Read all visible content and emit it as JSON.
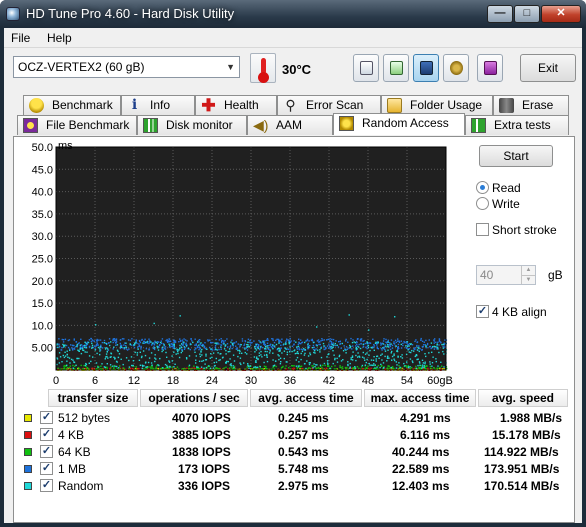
{
  "window": {
    "title": "HD Tune Pro 4.60 - Hard Disk Utility",
    "minimize": "—",
    "maximize": "□",
    "close": "✕"
  },
  "menu": [
    {
      "label": "File"
    },
    {
      "label": "Help"
    }
  ],
  "toolbar": {
    "drive": "OCZ-VERTEX2 (60 gB)",
    "temperature": "30°C",
    "exit_label": "Exit"
  },
  "tabs_row1": [
    {
      "label": "Benchmark",
      "icon": "benchmark-icon"
    },
    {
      "label": "Info",
      "icon": "info-icon"
    },
    {
      "label": "Health",
      "icon": "health-icon"
    },
    {
      "label": "Error Scan",
      "icon": "error-scan-icon"
    },
    {
      "label": "Folder Usage",
      "icon": "folder-icon"
    },
    {
      "label": "Erase",
      "icon": "trash-icon"
    }
  ],
  "tabs_row2": [
    {
      "label": "File Benchmark",
      "icon": "file-benchmark-icon"
    },
    {
      "label": "Disk monitor",
      "icon": "disk-monitor-icon"
    },
    {
      "label": "AAM",
      "icon": "speaker-icon"
    },
    {
      "label": "Random Access",
      "icon": "random-access-icon",
      "selected": true
    },
    {
      "label": "Extra tests",
      "icon": "extra-tests-icon"
    }
  ],
  "controls": {
    "start_label": "Start",
    "read_label": "Read",
    "write_label": "Write",
    "mode": "Read",
    "short_stroke_label": "Short stroke",
    "short_stroke_checked": false,
    "short_stroke_value": "40",
    "short_stroke_unit": "gB",
    "align_label": "4 KB align",
    "align_checked": true
  },
  "chart_data": {
    "type": "scatter",
    "y_unit": "ms",
    "ylim": [
      0,
      50
    ],
    "xlim": [
      0,
      60
    ],
    "y_ticks": [
      "50.0",
      "45.0",
      "40.0",
      "35.0",
      "30.0",
      "25.0",
      "20.0",
      "15.0",
      "10.0",
      "5.00"
    ],
    "x_ticks": [
      "0",
      "6",
      "12",
      "18",
      "24",
      "30",
      "36",
      "42",
      "48",
      "54",
      "60gB"
    ],
    "background": "#202020",
    "grid": true,
    "series": [
      {
        "name": "512 bytes",
        "color": "#e8e800",
        "band": [
          0.1,
          0.5
        ]
      },
      {
        "name": "4 KB",
        "color": "#dd1010",
        "band": [
          0.1,
          0.6
        ]
      },
      {
        "name": "64 KB",
        "color": "#10c010",
        "band": [
          0.3,
          1.2
        ]
      },
      {
        "name": "1 MB",
        "color": "#1e73dc",
        "band": [
          4.6,
          7.2
        ]
      },
      {
        "name": "Random",
        "color": "#20d8d8",
        "band": [
          0.5,
          6.5
        ]
      }
    ]
  },
  "results": {
    "headers": [
      "transfer size",
      "operations / sec",
      "avg. access time",
      "max. access time",
      "avg. speed"
    ],
    "rows": [
      {
        "name": "512 bytes",
        "ops": "4070 IOPS",
        "avg": "0.245 ms",
        "max": "4.291 ms",
        "speed": "1.988 MB/s",
        "color": "#e8e800"
      },
      {
        "name": "4 KB",
        "ops": "3885 IOPS",
        "avg": "0.257 ms",
        "max": "6.116 ms",
        "speed": "15.178 MB/s",
        "color": "#dd1010"
      },
      {
        "name": "64 KB",
        "ops": "1838 IOPS",
        "avg": "0.543 ms",
        "max": "40.244 ms",
        "speed": "114.922 MB/s",
        "color": "#10c010"
      },
      {
        "name": "1 MB",
        "ops": "173 IOPS",
        "avg": "5.748 ms",
        "max": "22.589 ms",
        "speed": "173.951 MB/s",
        "color": "#1e73dc"
      },
      {
        "name": "Random",
        "ops": "336 IOPS",
        "avg": "2.975 ms",
        "max": "12.403 ms",
        "speed": "170.514 MB/s",
        "color": "#20d8d8"
      }
    ]
  }
}
